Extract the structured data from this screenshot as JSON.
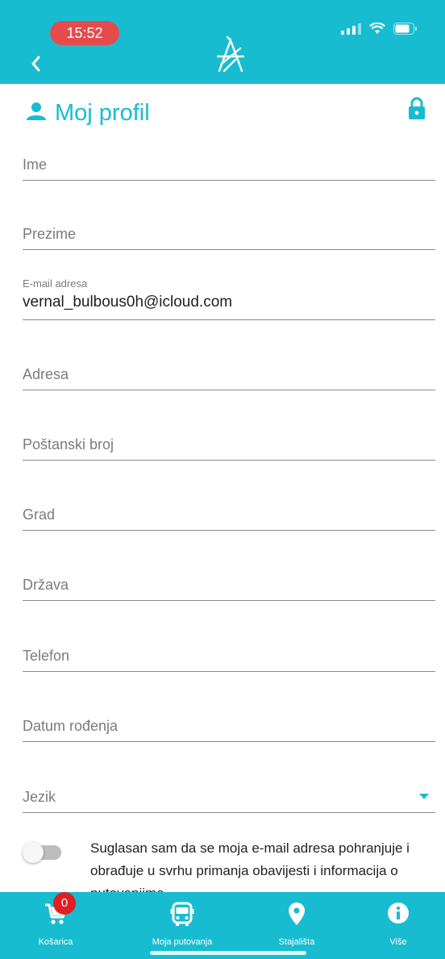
{
  "status_bar": {
    "time": "15:52"
  },
  "colors": {
    "accent": "#18bcd0",
    "badge": "#e02020",
    "time_pill": "#e54b4b"
  },
  "header": {
    "back_icon": "chevron-left-icon",
    "logo_icon": "app-logo-icon"
  },
  "page": {
    "title": "Moj profil",
    "title_icon": "person-icon",
    "lock_icon": "lock-icon"
  },
  "form": {
    "ime": {
      "placeholder": "Ime"
    },
    "prezime": {
      "placeholder": "Prezime"
    },
    "email": {
      "label": "E-mail adresa",
      "value": "vernal_bulbous0h@icloud.com"
    },
    "adresa": {
      "placeholder": "Adresa"
    },
    "postanski_broj": {
      "placeholder": "Poštanski broj"
    },
    "grad": {
      "placeholder": "Grad"
    },
    "drzava": {
      "placeholder": "Država"
    },
    "telefon": {
      "placeholder": "Telefon"
    },
    "datum_rodenja": {
      "placeholder": "Datum rođenja"
    },
    "jezik": {
      "placeholder": "Jezik"
    }
  },
  "consent": {
    "text": "Suglasan sam da se moja e-mail adresa pohranjuje i obrađuje u svrhu primanja obavijesti i informacija o putovanjima.",
    "enabled": false
  },
  "bottom_nav": {
    "items": [
      {
        "label": "Košarica",
        "icon": "cart-icon",
        "badge": "0"
      },
      {
        "label": "Moja putovanja",
        "icon": "bus-icon"
      },
      {
        "label": "Stajališta",
        "icon": "map-pin-icon"
      },
      {
        "label": "Više",
        "icon": "info-icon"
      }
    ]
  }
}
